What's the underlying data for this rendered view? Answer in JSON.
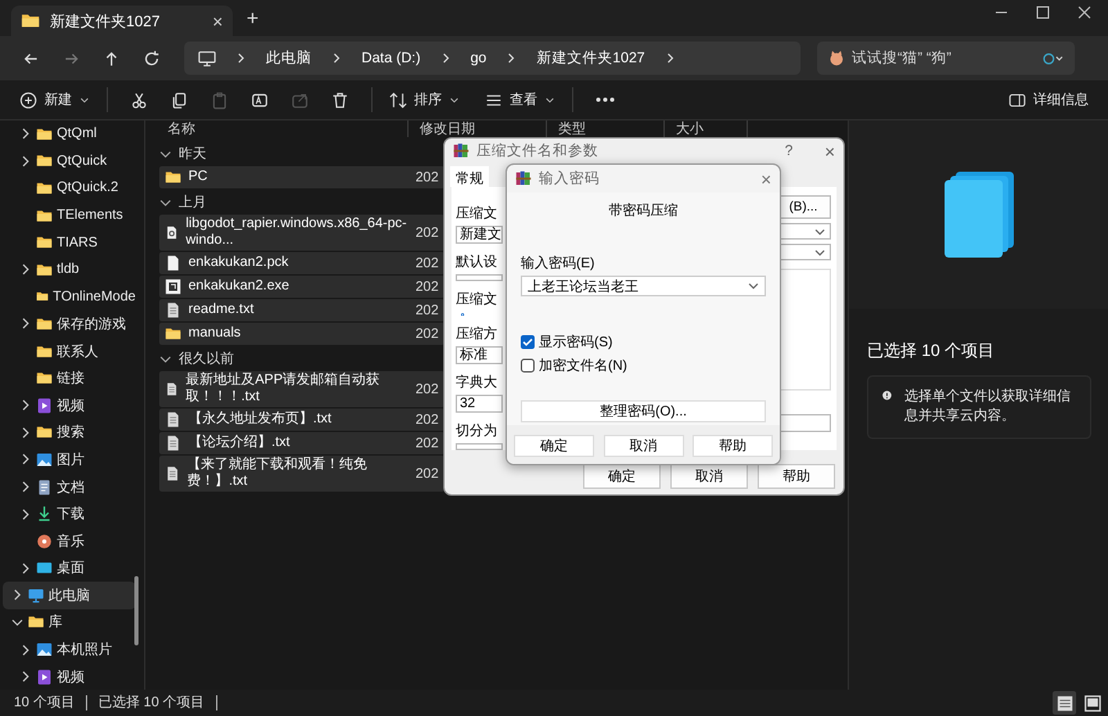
{
  "window": {
    "tab_title": "新建文件夹1027",
    "tab_close": "×",
    "new_tab": "+"
  },
  "address": {
    "crumbs": [
      "此电脑",
      "Data (D:)",
      "go",
      "新建文件夹1027"
    ],
    "search_placeholder": "试试搜“猫” “狗”"
  },
  "toolbar": {
    "new": "新建",
    "sort": "排序",
    "view": "查看",
    "details": "详细信息",
    "actions": [
      {
        "kind": "cut",
        "disabled": false
      },
      {
        "kind": "copy",
        "disabled": false
      },
      {
        "kind": "paste",
        "disabled": true
      },
      {
        "kind": "rename",
        "disabled": false
      },
      {
        "kind": "share",
        "disabled": true
      },
      {
        "kind": "delete",
        "disabled": false
      }
    ]
  },
  "sidebar": {
    "continued_items": [
      {
        "label": "QtQml",
        "kind": "folder",
        "expandable": true,
        "expanded": false,
        "selected": false
      },
      {
        "label": "QtQuick",
        "kind": "folder",
        "expandable": true,
        "expanded": false,
        "selected": false
      },
      {
        "label": "QtQuick.2",
        "kind": "folder",
        "expandable": false,
        "selected": false
      },
      {
        "label": "TElements",
        "kind": "folder",
        "expandable": false,
        "selected": false
      },
      {
        "label": "TIARS",
        "kind": "folder",
        "expandable": false,
        "selected": false
      },
      {
        "label": "tldb",
        "kind": "folder",
        "expandable": true,
        "expanded": false,
        "selected": false
      },
      {
        "label": "TOnlineMode",
        "kind": "folder",
        "expandable": false,
        "selected": false
      },
      {
        "label": "保存的游戏",
        "kind": "folder",
        "expandable": true,
        "expanded": false,
        "selected": false
      },
      {
        "label": "联系人",
        "kind": "folder",
        "expandable": false,
        "selected": false
      },
      {
        "label": "链接",
        "kind": "folder",
        "expandable": false,
        "selected": false
      },
      {
        "label": "视频",
        "kind": "video",
        "expandable": true,
        "expanded": false,
        "selected": false
      },
      {
        "label": "搜索",
        "kind": "folder",
        "expandable": true,
        "expanded": false,
        "selected": false
      },
      {
        "label": "图片",
        "kind": "picture",
        "expandable": true,
        "expanded": false,
        "selected": false
      },
      {
        "label": "文档",
        "kind": "document",
        "expandable": true,
        "expanded": false,
        "selected": false
      },
      {
        "label": "下载",
        "kind": "download",
        "expandable": true,
        "expanded": false,
        "selected": false
      },
      {
        "label": "音乐",
        "kind": "music",
        "expandable": false,
        "selected": false
      },
      {
        "label": "桌面",
        "kind": "desktop",
        "expandable": true,
        "expanded": false,
        "selected": false
      }
    ],
    "items": [
      {
        "label": "此电脑",
        "kind": "pc",
        "expandable": true,
        "expanded": false,
        "selected": true
      },
      {
        "label": "库",
        "kind": "folder",
        "expandable": true,
        "expanded": true,
        "selected": false,
        "children": [
          {
            "label": "本机照片",
            "kind": "picture",
            "expandable": true,
            "expanded": false,
            "selected": false
          },
          {
            "label": "视频",
            "kind": "video",
            "expandable": true,
            "expanded": false,
            "selected": false
          }
        ]
      }
    ]
  },
  "file_list": {
    "columns": [
      "名称",
      "修改日期",
      "类型",
      "大小"
    ],
    "groups": [
      {
        "label": "昨天",
        "expanded": true,
        "rows": [
          {
            "name": "PC",
            "kind": "folder",
            "date": "202",
            "selected": true
          }
        ]
      },
      {
        "label": "上月",
        "expanded": true,
        "rows": [
          {
            "name": "libgodot_rapier.windows.x86_64-pc-windo...",
            "kind": "library",
            "date": "202",
            "selected": true
          },
          {
            "name": "enkakukan2.pck",
            "kind": "file",
            "date": "202",
            "selected": true
          },
          {
            "name": "enkakukan2.exe",
            "kind": "app",
            "date": "202",
            "selected": true
          },
          {
            "name": "readme.txt",
            "kind": "text",
            "date": "202",
            "selected": true
          },
          {
            "name": "manuals",
            "kind": "folder",
            "date": "202",
            "selected": true
          }
        ]
      },
      {
        "label": "很久以前",
        "expanded": true,
        "rows": [
          {
            "name": "最新地址及APP请发邮箱自动获取！！！.txt",
            "kind": "text",
            "date": "202",
            "selected": true
          },
          {
            "name": "【永久地址发布页】.txt",
            "kind": "text",
            "date": "202",
            "selected": true
          },
          {
            "name": "【论坛介绍】.txt",
            "kind": "text",
            "date": "202",
            "selected": true
          },
          {
            "name": "【来了就能下载和观看！纯免费！】.txt",
            "kind": "text",
            "date": "202",
            "selected": true
          }
        ]
      }
    ]
  },
  "details_pane": {
    "title": "已选择 10 个项目",
    "info": "选择单个文件以获取详细信息并共享云内容。"
  },
  "status_bar": {
    "items": [
      "10 个项目",
      "已选择 10 个项目"
    ],
    "views": [
      {
        "kind": "details",
        "selected": true
      },
      {
        "kind": "tiles",
        "selected": false
      }
    ]
  },
  "archive_dialog": {
    "title": "压缩文件名和参数",
    "help": "?",
    "close": "×",
    "tabs": [
      {
        "label": "常规",
        "selected": true
      }
    ],
    "left": [
      {
        "kind": "label",
        "text": "压缩文"
      },
      {
        "kind": "field",
        "value": "新建文"
      },
      {
        "kind": "label",
        "text": "默认设"
      },
      {
        "kind": "field"
      },
      {
        "kind": "group",
        "text": "压缩文"
      },
      {
        "kind": "radio",
        "selected": true
      },
      {
        "kind": "label",
        "text": "压缩方"
      },
      {
        "kind": "field",
        "value": "标准"
      },
      {
        "kind": "label",
        "text": "字典大"
      },
      {
        "kind": "field",
        "value": "32"
      },
      {
        "kind": "label",
        "text": "切分为"
      },
      {
        "kind": "field"
      }
    ],
    "right": [
      {
        "kind": "button",
        "text": "(B)..."
      },
      {
        "kind": "dropdown"
      },
      {
        "kind": "dropdown"
      },
      {
        "kind": "group"
      },
      {
        "kind": "field"
      }
    ],
    "buttons": [
      "确定",
      "取消",
      "帮助"
    ]
  },
  "password_dialog": {
    "title": "输入密码",
    "close": "×",
    "heading": "带密码压缩",
    "password_label": "输入密码(E)",
    "password_value": "上老王论坛当老王",
    "options": [
      {
        "label": "显示密码(S)",
        "checked": true
      },
      {
        "label": "加密文件名(N)",
        "checked": false
      }
    ],
    "organize": "整理密码(O)...",
    "buttons": [
      "确定",
      "取消",
      "帮助"
    ]
  }
}
